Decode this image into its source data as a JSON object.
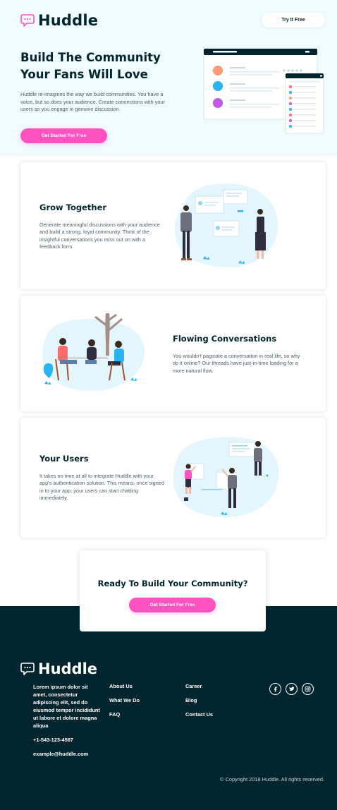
{
  "header": {
    "brand": "Huddle",
    "try_label": "Try It Free"
  },
  "hero": {
    "title": "Build The Community Your Fans Will Love",
    "text": "Huddle re-imagines the way we build communities. You have a voice, but so does your audience. Create connections with your users as you engage in genuine discussion.",
    "button": "Get Started For Free"
  },
  "features": [
    {
      "title": "Grow Together",
      "text": "Generate meaningful discussions with your audience and build a strong, loyal community. Think of the insightful conversations you miss out on with a feedback form."
    },
    {
      "title": "Flowing Conversations",
      "text": "You wouldn't paginate a conversation in real life, so why do it online? Our threads have just-in-time loading for a more natural flow."
    },
    {
      "title": "Your Users",
      "text": "It takes no time at all to integrate Huddle with your app's authentication solution. This means, once signed in to your app, your users can start chatting immediately."
    }
  ],
  "cta": {
    "title": "Ready To Build Your Community?",
    "button": "Get Started For Free"
  },
  "footer": {
    "brand": "Huddle",
    "about": "Lorem ipsum dolor sit amet, consectetur adipiscing elit, sed do eiusmod tempor incididunt ut labore et dolore magna aliqua",
    "phone": "+1-543-123-4567",
    "email": "example@huddle.com",
    "links_col1": [
      "About Us",
      "What We Do",
      "FAQ"
    ],
    "links_col2": [
      "Career",
      "Blog",
      "Contact Us"
    ],
    "social": [
      "facebook-icon",
      "twitter-icon",
      "instagram-icon"
    ],
    "copyright": "© Copyright 2018 Huddle. All rights reserved."
  },
  "colors": {
    "dark": "#00252e",
    "pink": "#ff52c1",
    "hero_bg": "#f0fbfe",
    "light_blue": "#e3f6fd"
  }
}
